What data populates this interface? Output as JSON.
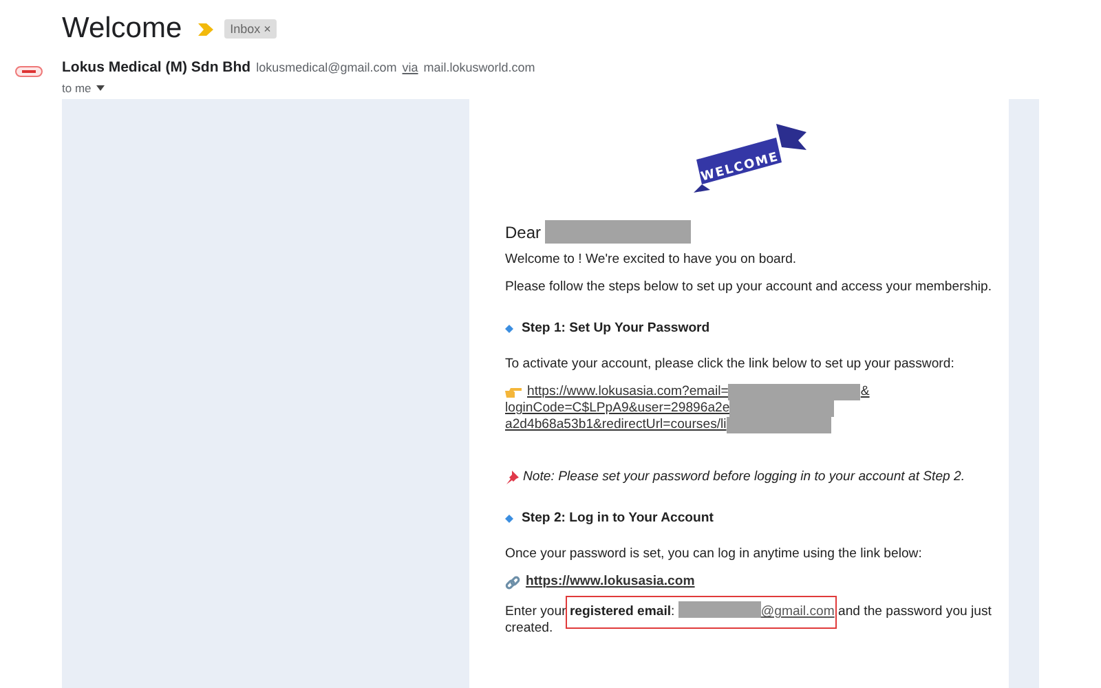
{
  "message": {
    "subject": "Welcome",
    "important": true,
    "labels": [
      {
        "text": "Inbox",
        "close": "×"
      }
    ],
    "sender": {
      "name": "Lokus Medical (M) Sdn Bhd",
      "email": "lokusmedical@gmail.com",
      "via": "via",
      "via_domain": "mail.lokusworld.com"
    },
    "recipients": "to me"
  },
  "body": {
    "banner": "WELCOME",
    "blocks": [
      {
        "kind": "greeting",
        "text": "Dear",
        "redacted": true
      },
      {
        "kind": "paragraph",
        "text": "Welcome to ! We're excited to have you on board."
      },
      {
        "kind": "paragraph",
        "text": "Please follow the steps below to set up your account and access your membership."
      },
      {
        "kind": "step",
        "text": "Step 1: Set Up Your Password"
      },
      {
        "kind": "paragraph",
        "text": "To activate your account, please click the link below to set up your password:"
      },
      {
        "kind": "long_link",
        "lines": [
          "https://www.lokusasia.com?email=",
          "loginCode=C$LPpA9&user=29896a2e",
          "a2d4b68a53b1&redirectUrl=courses/li"
        ],
        "tail": "&",
        "redacted": true
      },
      {
        "kind": "note",
        "text": "Note: Please set your password before logging in to your account at Step 2."
      },
      {
        "kind": "step",
        "text": "Step 2: Log in to Your Account"
      },
      {
        "kind": "paragraph",
        "text": "Once your password is set, you can log in anytime using the link below:"
      },
      {
        "kind": "link",
        "text": "https://www.lokusasia.com"
      },
      {
        "kind": "email_line",
        "before": "Enter your **registered email**: ",
        "link": "@gmail.com",
        "after": " and the password you just created.",
        "redacted": true,
        "highlighted": true
      }
    ]
  }
}
